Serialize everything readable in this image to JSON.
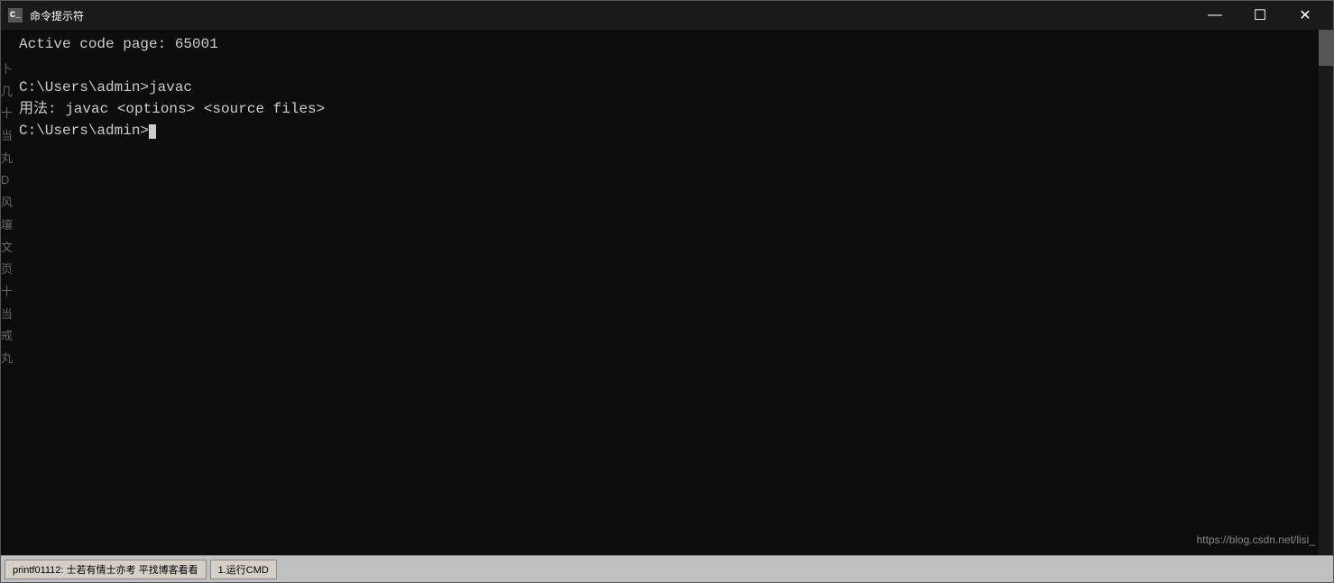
{
  "window": {
    "title": "命令提示符",
    "icon": "C_",
    "controls": {
      "minimize": "—",
      "maximize": "☐",
      "close": "✕"
    }
  },
  "terminal": {
    "lines": [
      "Active code page: 65001",
      "",
      "C:\\Users\\admin>javac",
      "用法: javac <options> <source files>",
      "C:\\Users\\admin>"
    ],
    "prompt": "C:\\Users\\admin>"
  },
  "sidebar_chars": [
    "卜",
    "几",
    "十",
    "当",
    "丸",
    "D",
    "风",
    "壤",
    "文",
    "页",
    "十",
    "当",
    "戒",
    "丸"
  ],
  "watermark": "https://blog.csdn.net/lisi_",
  "bottom_bar": {
    "items": [
      "printf01112: 士若有情士亦考 平找博客看看",
      "1.运行CMD"
    ]
  }
}
